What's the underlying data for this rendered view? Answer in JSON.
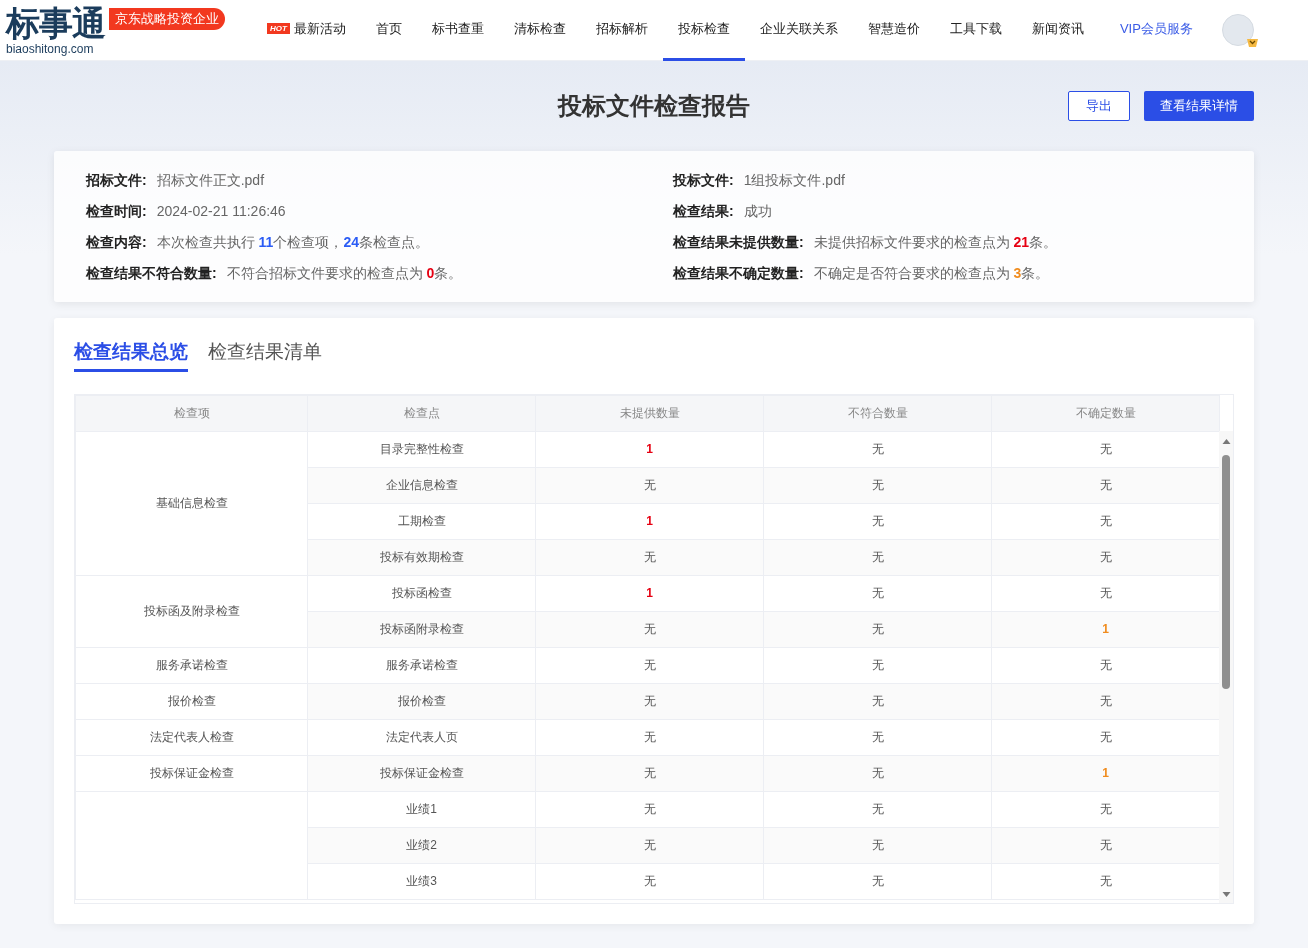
{
  "logo": {
    "mark": "标事通",
    "domain": "biaoshitong.com",
    "badge": "京东战略投资企业"
  },
  "nav": [
    {
      "label": "最新活动",
      "hot": "HOT",
      "selected": false,
      "kind": "plain"
    },
    {
      "label": "首页",
      "selected": false,
      "kind": "plain"
    },
    {
      "label": "标书查重",
      "selected": false,
      "kind": "plain"
    },
    {
      "label": "清标检查",
      "selected": false,
      "kind": "plain"
    },
    {
      "label": "招标解析",
      "selected": false,
      "kind": "plain"
    },
    {
      "label": "投标检查",
      "selected": true,
      "kind": "plain"
    },
    {
      "label": "企业关联关系",
      "selected": false,
      "kind": "plain"
    },
    {
      "label": "智慧造价",
      "selected": false,
      "kind": "plain"
    },
    {
      "label": "工具下载",
      "selected": false,
      "kind": "plain"
    },
    {
      "label": "新闻资讯",
      "selected": false,
      "kind": "plain"
    },
    {
      "label": "VIP会员服务",
      "selected": false,
      "kind": "vip"
    }
  ],
  "title": "投标文件检查报告",
  "buttons": [
    {
      "label": "导出",
      "kind": "outline"
    },
    {
      "label": "查看结果详情",
      "kind": "primary"
    }
  ],
  "info": [
    {
      "label": "招标文件:",
      "parts": [
        {
          "text": "招标文件正文.pdf"
        }
      ]
    },
    {
      "label": "投标文件:",
      "parts": [
        {
          "text": "1组投标文件.pdf"
        }
      ]
    },
    {
      "label": "检查时间:",
      "parts": [
        {
          "text": "2024-02-21 11:26:46"
        }
      ]
    },
    {
      "label": "检查结果:",
      "parts": [
        {
          "text": "成功"
        }
      ]
    },
    {
      "label": "检查内容:",
      "parts": [
        {
          "text": "本次检查共执行 "
        },
        {
          "text": "11",
          "color": "#2b5cf5"
        },
        {
          "text": "个检查项，"
        },
        {
          "text": "24",
          "color": "#2b5cf5"
        },
        {
          "text": "条检查点。"
        }
      ]
    },
    {
      "label": "检查结果未提供数量:",
      "parts": [
        {
          "text": "未提供招标文件要求的检查点为 "
        },
        {
          "text": "21",
          "color": "#e60012"
        },
        {
          "text": "条。"
        }
      ]
    },
    {
      "label": "检查结果不符合数量:",
      "parts": [
        {
          "text": "不符合招标文件要求的检查点为 "
        },
        {
          "text": "0",
          "color": "#e60012"
        },
        {
          "text": "条。"
        }
      ]
    },
    {
      "label": "检查结果不确定数量:",
      "parts": [
        {
          "text": "不确定是否符合要求的检查点为 "
        },
        {
          "text": "3",
          "color": "#f08c1e"
        },
        {
          "text": "条。"
        }
      ]
    }
  ],
  "tabs": [
    {
      "label": "检查结果总览",
      "selected": true
    },
    {
      "label": "检查结果清单",
      "selected": false
    }
  ],
  "table": {
    "columns": [
      {
        "label": "检查项"
      },
      {
        "label": "检查点"
      },
      {
        "label": "未提供数量",
        "color": "#e60012"
      },
      {
        "label": "不符合数量"
      },
      {
        "label": "不确定数量",
        "color": "#f08c1e"
      }
    ],
    "groups": [
      {
        "name": "基础信息检查",
        "rows": [
          [
            "目录完整性检查",
            "1",
            "无",
            "无"
          ],
          [
            "企业信息检查",
            "无",
            "无",
            "无"
          ],
          [
            "工期检查",
            "1",
            "无",
            "无"
          ],
          [
            "投标有效期检查",
            "无",
            "无",
            "无"
          ]
        ]
      },
      {
        "name": "投标函及附录检查",
        "rows": [
          [
            "投标函检查",
            "1",
            "无",
            "无"
          ],
          [
            "投标函附录检查",
            "无",
            "无",
            "1"
          ]
        ]
      },
      {
        "name": "服务承诺检查",
        "rows": [
          [
            "服务承诺检查",
            "无",
            "无",
            "无"
          ]
        ]
      },
      {
        "name": "报价检查",
        "rows": [
          [
            "报价检查",
            "无",
            "无",
            "无"
          ]
        ]
      },
      {
        "name": "法定代表人检查",
        "rows": [
          [
            "法定代表人页",
            "无",
            "无",
            "无"
          ]
        ]
      },
      {
        "name": "投标保证金检查",
        "rows": [
          [
            "投标保证金检查",
            "无",
            "无",
            "1"
          ]
        ]
      },
      {
        "rows": [
          [
            "业绩1",
            "无",
            "无",
            "无"
          ],
          [
            "业绩2",
            "无",
            "无",
            "无"
          ],
          [
            "业绩3",
            "无",
            "无",
            "无"
          ]
        ]
      }
    ]
  }
}
